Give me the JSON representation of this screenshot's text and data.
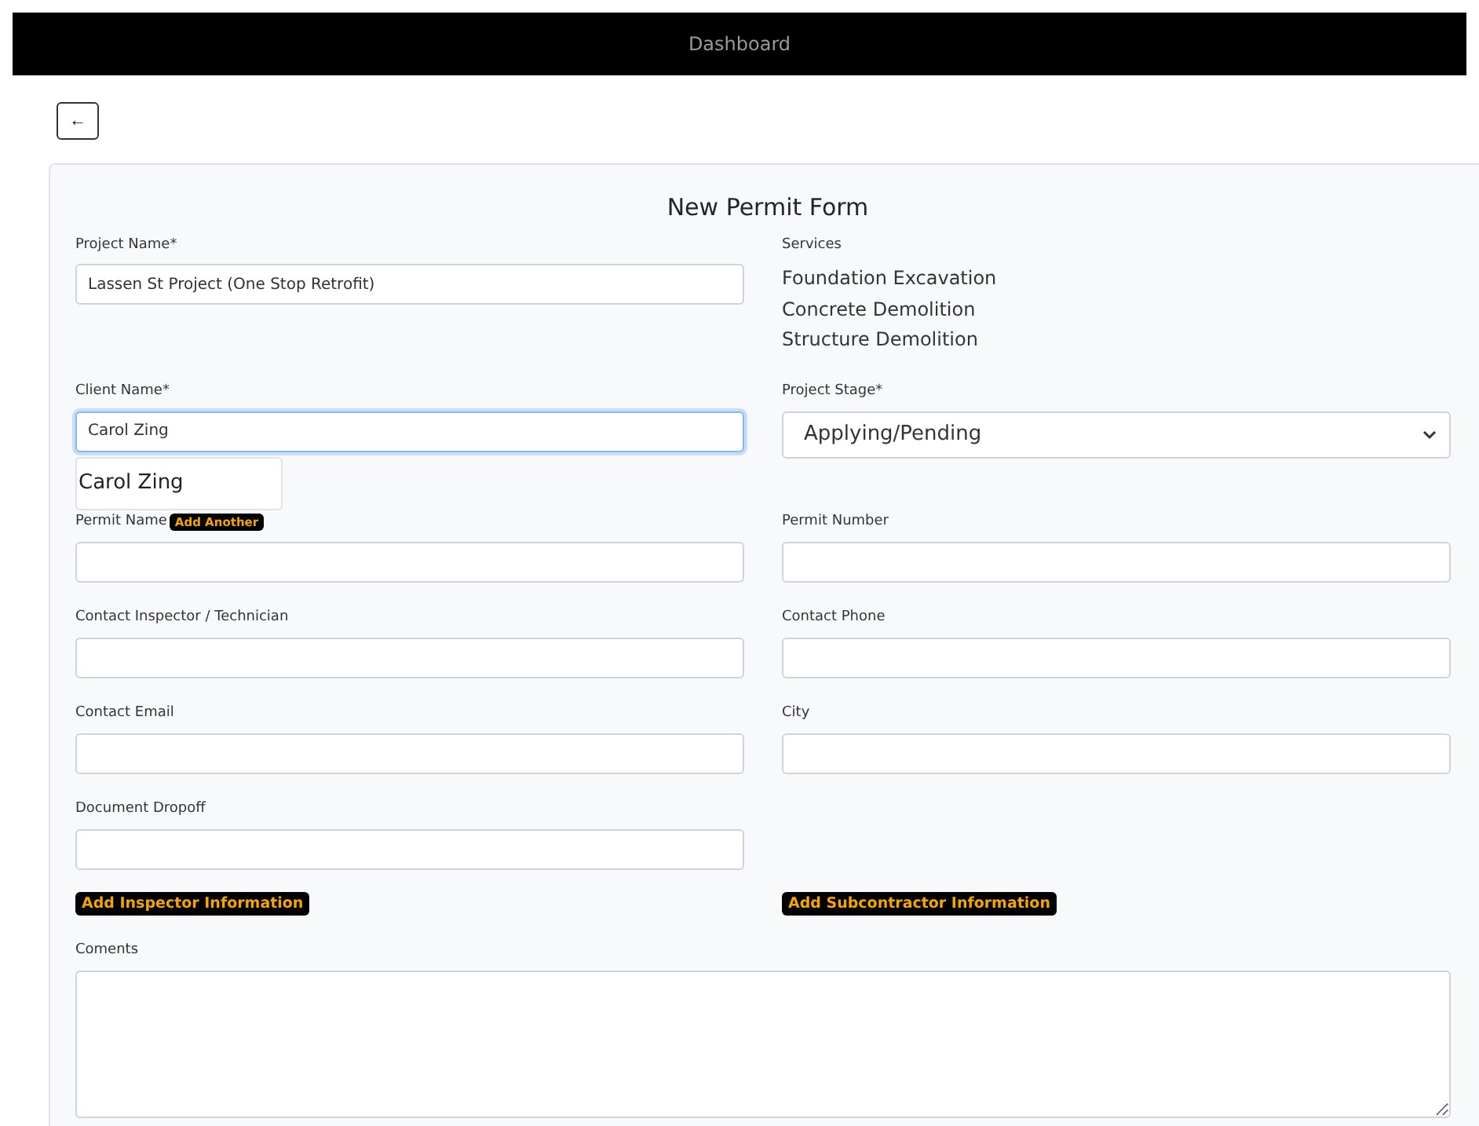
{
  "header": {
    "title": "Dashboard"
  },
  "back_button": {
    "label": "←"
  },
  "form": {
    "title": "New Permit Form",
    "fields": [
      {
        "kind": "input",
        "label": "Project Name*",
        "value": "Lassen St Project (One Stop Retrofit)",
        "focused": false
      },
      {
        "kind": "list",
        "label": "Services",
        "items": [
          "Foundation Excavation",
          "Concrete Demolition",
          "Structure Demolition"
        ]
      },
      {
        "kind": "input",
        "label": "Client Name*",
        "value": "Carol Zing",
        "focused": true,
        "suggestions": [
          "Carol Zing"
        ]
      },
      {
        "kind": "select",
        "label": "Project Stage*",
        "value": "Applying/Pending"
      },
      {
        "kind": "input",
        "label": "Permit Name",
        "badge": "Add Another",
        "focused": false
      },
      {
        "kind": "input",
        "label": "Permit Number",
        "focused": false
      },
      {
        "kind": "input",
        "label": "Contact Inspector / Technician",
        "focused": false
      },
      {
        "kind": "input",
        "label": "Contact Phone",
        "focused": false
      },
      {
        "kind": "input",
        "label": "Contact Email",
        "focused": false
      },
      {
        "kind": "input",
        "label": "City",
        "focused": false
      },
      {
        "kind": "input",
        "label": "Document Dropoff",
        "focused": false
      }
    ],
    "buttons": [
      "Add Inspector Information",
      "Add Subcontractor Information"
    ],
    "comments": {
      "label": "Coments"
    }
  }
}
